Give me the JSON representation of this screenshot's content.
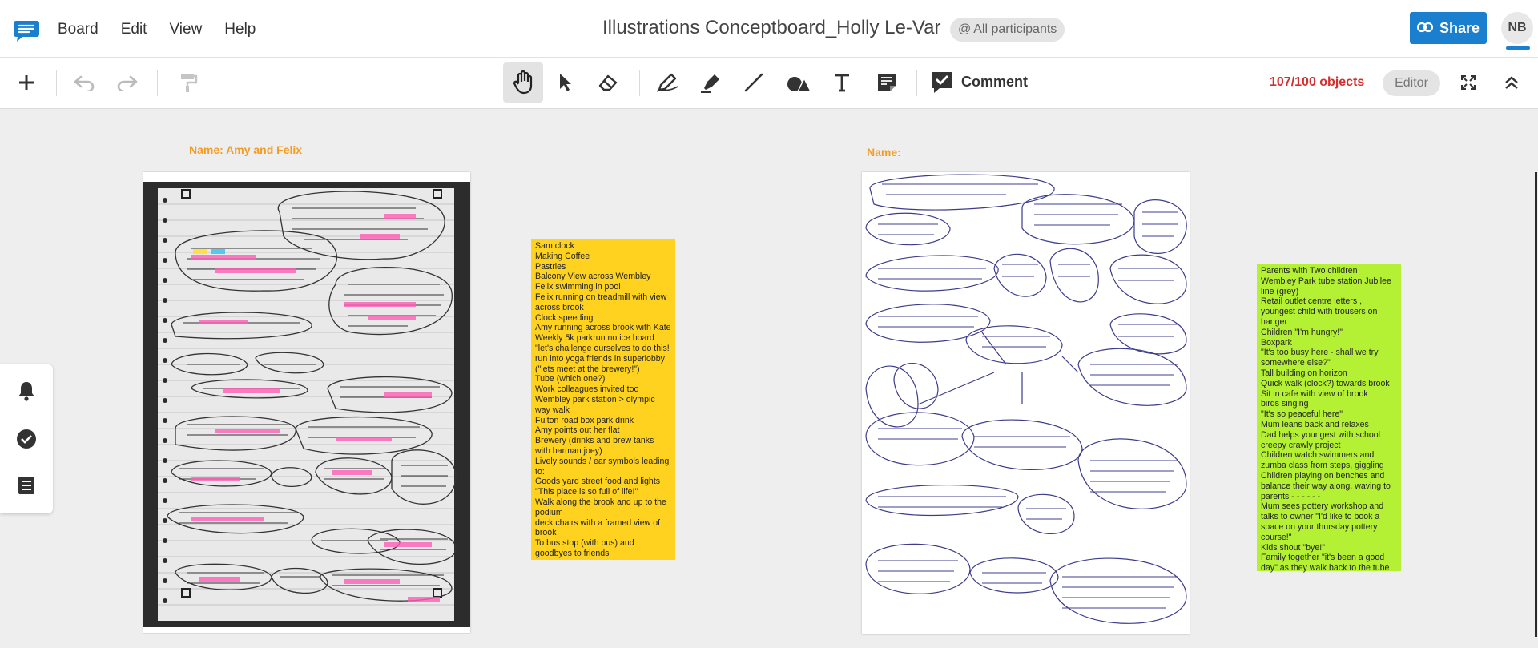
{
  "menu": {
    "items": [
      "Board",
      "Edit",
      "View",
      "Help"
    ]
  },
  "board": {
    "title": "Illustrations Conceptboard_Holly Le-Var",
    "participants": "All participants"
  },
  "header": {
    "share_label": "Share",
    "avatar_initials": "NB"
  },
  "toolbar": {
    "comment_label": "Comment",
    "objects_count": "107/100 objects",
    "editor_label": "Editor"
  },
  "canvas": {
    "name_left": "Name: Amy and Felix",
    "name_right": "Name:",
    "yellow_note": [
      "Sam clock",
      "Making Coffee",
      "Pastries",
      "Balcony View across Wembley",
      "Felix swimming in pool",
      "Felix running on treadmill with view across brook",
      "Clock speeding",
      "Amy running across brook with Kate",
      "Weekly 5k parkrun notice board",
      "\"let's challenge ourselves to do this!",
      "run into yoga friends in superlobby",
      "(\"lets meet at the brewery!\")",
      "Tube (which one?)",
      "Work colleagues invited too",
      "Wembley park station > olympic way walk",
      "Fulton road box park drink",
      "Amy points out her flat",
      "Brewery (drinks and brew tanks with barman joey)",
      "Lively sounds / ear symbols leading to:",
      "Goods yard street food and lights",
      "\"This place is so full of life!\"",
      "Walk along the brook and up to the podium",
      "deck chairs with a framed view of brook",
      "To bus stop (with bus) and goodbyes to friends"
    ],
    "green_note": [
      "Parents with Two children",
      "Wembley Park tube station Jubilee line (grey)",
      "Retail outlet centre letters , youngest child with trousers on hanger",
      "Children \"I'm hungry!\"",
      "Boxpark",
      "\"It's too busy here - shall we try somewhere else?\"",
      "Tall building on horizon",
      "Quick walk (clock?) towards brook",
      "Sit in cafe with view of brook",
      "birds singing",
      "\"It's so peaceful here\"",
      "Mum leans back and relaxes",
      "Dad helps youngest with school creepy crawly project",
      "Children watch swimmers and zumba class from steps, giggling",
      "Children playing on benches and balance their way along, waving to parents - - - - - -",
      "Mum sees pottery workshop and talks to owner \"I'd like to book a space on your thursday pottery course!\"",
      "Kids shout \"bye!\"",
      "Family together \"it's been a good day\" as they walk back to the tube"
    ]
  },
  "icons": {
    "logo": "conceptboard-logo-icon",
    "share": "link-icon",
    "participants": "at-icon",
    "add": "plus-icon",
    "undo": "undo-icon",
    "redo": "redo-icon",
    "format": "paint-roller-icon",
    "hand": "hand-icon",
    "select": "cursor-icon",
    "eraser": "eraser-icon",
    "pen": "pen-icon",
    "highlighter": "highlighter-icon",
    "line": "line-icon",
    "shapes": "shapes-icon",
    "text": "text-icon",
    "sticky": "sticky-note-icon",
    "comment": "comment-icon",
    "fullscreen": "fullscreen-icon",
    "collapse": "collapse-icon",
    "bell": "bell-icon",
    "check": "check-circle-icon",
    "list": "list-icon"
  },
  "colors": {
    "accent": "#1a7fcf",
    "name_label": "#f39c24",
    "limit_warning": "#d32f2f",
    "note_yellow": "#ffd21f",
    "note_green": "#b4f033",
    "sketch_highlight": "#ff5fb8",
    "sketch_ink": "#3c3c8c"
  }
}
